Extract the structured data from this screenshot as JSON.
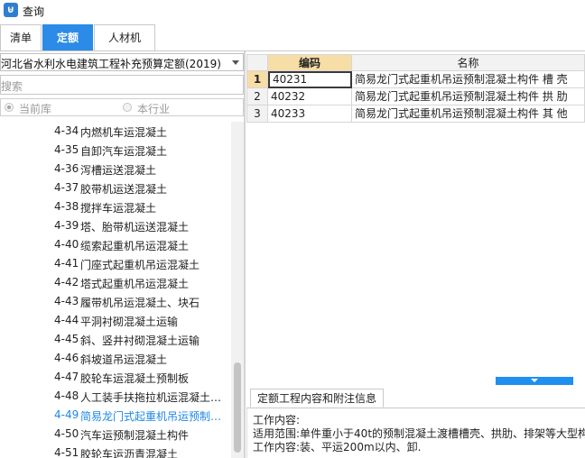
{
  "window": {
    "title": "查询",
    "icon": "app-logo-icon"
  },
  "tabs": [
    {
      "label": "清单",
      "active": false
    },
    {
      "label": "定额",
      "active": true
    },
    {
      "label": "人材机",
      "active": false
    }
  ],
  "library": {
    "selected": "河北省水利水电建筑工程补充预算定额(2019)"
  },
  "search": {
    "placeholder": "搜索"
  },
  "scope": {
    "options": [
      {
        "label": "当前库",
        "selected": true
      },
      {
        "label": "本行业",
        "selected": false
      }
    ]
  },
  "tree": {
    "items": [
      {
        "code": "4-34",
        "label": "内燃机车运混凝土"
      },
      {
        "code": "4-35",
        "label": "自卸汽车运混凝土"
      },
      {
        "code": "4-36",
        "label": "泻槽运送混凝土"
      },
      {
        "code": "4-37",
        "label": "胶带机运送混凝土"
      },
      {
        "code": "4-38",
        "label": "搅拌车运混凝土"
      },
      {
        "code": "4-39",
        "label": "塔、胎带机运送混凝土"
      },
      {
        "code": "4-40",
        "label": "缆索起重机吊运混凝土"
      },
      {
        "code": "4-41",
        "label": "门座式起重机吊运混凝土"
      },
      {
        "code": "4-42",
        "label": "塔式起重机吊运混凝土"
      },
      {
        "code": "4-43",
        "label": "履带机吊运混凝土、块石"
      },
      {
        "code": "4-44",
        "label": "平洞衬砌混凝土运输"
      },
      {
        "code": "4-45",
        "label": "斜、竖井衬砌混凝土运输"
      },
      {
        "code": "4-46",
        "label": "斜坡道吊运混凝土"
      },
      {
        "code": "4-47",
        "label": "胶轮车运混凝土预制板"
      },
      {
        "code": "4-48",
        "label": "人工装手扶拖拉机运混凝土…"
      },
      {
        "code": "4-49",
        "label": "简易龙门式起重机吊运预制…",
        "selected": true
      },
      {
        "code": "4-50",
        "label": "汽车运预制混凝土构件"
      },
      {
        "code": "4-51",
        "label": "胶轮车运沥青混凝土"
      }
    ]
  },
  "grid": {
    "headers": {
      "code": "编码",
      "name": "名称"
    },
    "rows": [
      {
        "num": "1",
        "code": "40231",
        "name": "简易龙门式起重机吊运预制混凝土构件 槽 壳"
      },
      {
        "num": "2",
        "code": "40232",
        "name": "简易龙门式起重机吊运预制混凝土构件 拱 肋"
      },
      {
        "num": "3",
        "code": "40233",
        "name": "简易龙门式起重机吊运预制混凝土构件 其 他"
      }
    ]
  },
  "info": {
    "tab_label": "定额工程内容和附注信息",
    "lines": [
      "工作内容:",
      "适用范围:单件重小于40t的预制混凝土渡槽槽壳、拱肋、排架等大型构",
      "工作内容:装、平运200m以内、卸."
    ]
  },
  "colors": {
    "accent": "#2b8be6",
    "selected_text": "#1e88e5",
    "active_header": "#f7dda6"
  }
}
